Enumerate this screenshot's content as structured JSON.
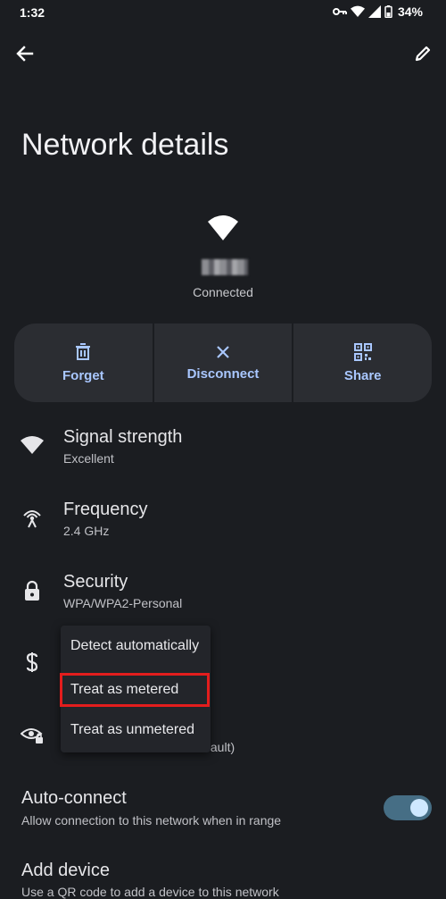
{
  "status_bar": {
    "time": "1:32",
    "battery": "34%",
    "icons": [
      "vpn-key-icon",
      "wifi-icon",
      "cell-signal-icon",
      "battery-icon"
    ]
  },
  "toolbar": {
    "back_icon": "arrow-left-icon",
    "edit_icon": "pencil-icon"
  },
  "page": {
    "title": "Network details",
    "connection_status": "Connected"
  },
  "actions": [
    {
      "label": "Forget",
      "icon": "trash-icon"
    },
    {
      "label": "Disconnect",
      "icon": "close-icon"
    },
    {
      "label": "Share",
      "icon": "qr-code-icon"
    }
  ],
  "details": [
    {
      "title": "Signal strength",
      "value": "Excellent",
      "icon": "wifi-icon"
    },
    {
      "title": "Frequency",
      "value": "2.4 GHz",
      "icon": "antenna-icon"
    },
    {
      "title": "Security",
      "value": "WPA/WPA2-Personal",
      "icon": "lock-icon"
    }
  ],
  "metered_row": {
    "icon": "dollar-icon"
  },
  "privacy_row": {
    "icon": "eye-lock-icon",
    "value_partial": "fault)"
  },
  "metered_menu": {
    "options": [
      "Detect automatically",
      "Treat as metered",
      "Treat as unmetered"
    ],
    "highlighted_index": 1
  },
  "auto_connect": {
    "title": "Auto-connect",
    "subtitle": "Allow connection to this network when in range",
    "enabled": true
  },
  "add_device": {
    "title": "Add device",
    "subtitle": "Use a QR code to add a device to this network"
  },
  "colors": {
    "background": "#1b1d21",
    "card": "#2b2d32",
    "accent": "#a9c7ff",
    "highlight_box": "#e31d1d"
  }
}
